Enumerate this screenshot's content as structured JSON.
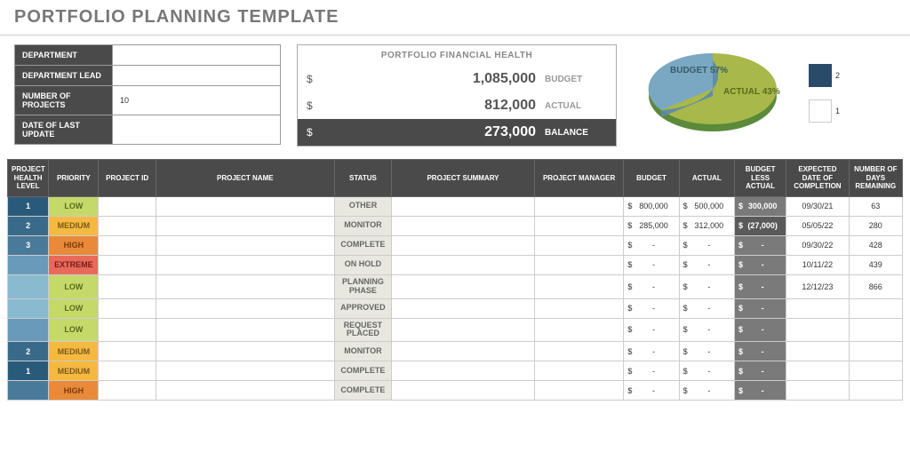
{
  "title": "PORTFOLIO PLANNING TEMPLATE",
  "meta": {
    "rows": [
      {
        "label": "DEPARTMENT",
        "value": ""
      },
      {
        "label": "DEPARTMENT LEAD",
        "value": ""
      },
      {
        "label": "NUMBER OF PROJECTS",
        "value": "10"
      },
      {
        "label": "DATE OF LAST UPDATE",
        "value": ""
      }
    ]
  },
  "financial": {
    "title": "PORTFOLIO FINANCIAL HEALTH",
    "rows": [
      {
        "currency": "$",
        "amount": "1,085,000",
        "tag": "BUDGET"
      },
      {
        "currency": "$",
        "amount": "812,000",
        "tag": "ACTUAL"
      },
      {
        "currency": "$",
        "amount": "273,000",
        "tag": "BALANCE"
      }
    ]
  },
  "chart_data": {
    "type": "pie",
    "title": "",
    "slices": [
      {
        "name": "BUDGET",
        "value": 57,
        "label": "BUDGET 57%",
        "color": "#7aa8c2"
      },
      {
        "name": "ACTUAL",
        "value": 43,
        "label": "ACTUAL 43%",
        "color": "#a8b84a"
      }
    ],
    "legend": [
      {
        "label": "2",
        "color": "#2a4a6a"
      },
      {
        "label": "1",
        "color": "#ffffff"
      }
    ]
  },
  "columns": [
    "PROJECT HEALTH LEVEL",
    "PRIORITY",
    "PROJECT ID",
    "PROJECT NAME",
    "STATUS",
    "PROJECT SUMMARY",
    "PROJECT MANAGER",
    "BUDGET",
    "ACTUAL",
    "BUDGET LESS ACTUAL",
    "EXPECTED DATE OF COMPLETION",
    "NUMBER OF DAYS REMAINING"
  ],
  "rows": [
    {
      "health": "1",
      "hcls": "hl1",
      "priority": "LOW",
      "pcls": "pri-low",
      "status": "OTHER",
      "budget": "800,000",
      "actual": "500,000",
      "bla": "300,000",
      "blaCls": "bla-norm",
      "date": "09/30/21",
      "days": "63"
    },
    {
      "health": "2",
      "hcls": "hl2",
      "priority": "MEDIUM",
      "pcls": "pri-med",
      "status": "MONITOR",
      "budget": "285,000",
      "actual": "312,000",
      "bla": "(27,000)",
      "blaCls": "bla-neg",
      "date": "05/05/22",
      "days": "280"
    },
    {
      "health": "3",
      "hcls": "hl3",
      "priority": "HIGH",
      "pcls": "pri-high",
      "status": "COMPLETE",
      "budget": "-",
      "actual": "-",
      "bla": "-",
      "blaCls": "bla-norm",
      "date": "09/30/22",
      "days": "428"
    },
    {
      "health": "",
      "hcls": "hl4",
      "priority": "EXTREME",
      "pcls": "pri-ext",
      "status": "ON HOLD",
      "budget": "-",
      "actual": "-",
      "bla": "-",
      "blaCls": "bla-norm",
      "date": "10/11/22",
      "days": "439"
    },
    {
      "health": "",
      "hcls": "hl5",
      "priority": "LOW",
      "pcls": "pri-low",
      "status": "PLANNING PHASE",
      "budget": "-",
      "actual": "-",
      "bla": "-",
      "blaCls": "bla-norm",
      "date": "12/12/23",
      "days": "866"
    },
    {
      "health": "",
      "hcls": "hl5",
      "priority": "LOW",
      "pcls": "pri-low",
      "status": "APPROVED",
      "budget": "-",
      "actual": "-",
      "bla": "-",
      "blaCls": "bla-norm",
      "date": "",
      "days": ""
    },
    {
      "health": "",
      "hcls": "hl4",
      "priority": "LOW",
      "pcls": "pri-low",
      "status": "REQUEST PLACED",
      "budget": "-",
      "actual": "-",
      "bla": "-",
      "blaCls": "bla-norm",
      "date": "",
      "days": ""
    },
    {
      "health": "2",
      "hcls": "hl2",
      "priority": "MEDIUM",
      "pcls": "pri-med",
      "status": "MONITOR",
      "budget": "-",
      "actual": "-",
      "bla": "-",
      "blaCls": "bla-norm",
      "date": "",
      "days": ""
    },
    {
      "health": "1",
      "hcls": "hl1",
      "priority": "MEDIUM",
      "pcls": "pri-med",
      "status": "COMPLETE",
      "budget": "-",
      "actual": "-",
      "bla": "-",
      "blaCls": "bla-norm",
      "date": "",
      "days": ""
    },
    {
      "health": "",
      "hcls": "hl3",
      "priority": "HIGH",
      "pcls": "pri-high",
      "status": "COMPLETE",
      "budget": "-",
      "actual": "-",
      "bla": "-",
      "blaCls": "bla-norm",
      "date": "",
      "days": ""
    }
  ]
}
